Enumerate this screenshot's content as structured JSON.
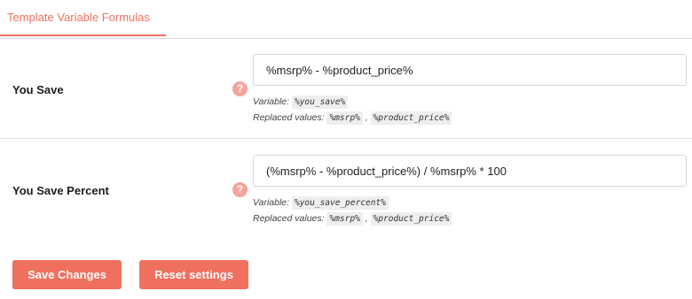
{
  "tabs": [
    {
      "label": "Template Variable Formulas"
    }
  ],
  "fields": [
    {
      "label": "You Save",
      "value": "%msrp% - %product_price%",
      "variable_label": "Variable:",
      "variable": "%you_save%",
      "replaced_label": "Replaced values:",
      "replaced": [
        "%msrp%",
        "%product_price%"
      ]
    },
    {
      "label": "You Save Percent",
      "value": "(%msrp% - %product_price%) / %msrp% * 100",
      "variable_label": "Variable:",
      "variable": "%you_save_percent%",
      "replaced_label": "Replaced values:",
      "replaced": [
        "%msrp%",
        "%product_price%"
      ]
    }
  ],
  "help_icon": {
    "glyph": "?",
    "icon": "question-icon",
    "color": "#f4a49a"
  },
  "separator": ",",
  "buttons": {
    "save": "Save Changes",
    "reset": "Reset settings"
  },
  "colors": {
    "accent": "#f0705f"
  }
}
